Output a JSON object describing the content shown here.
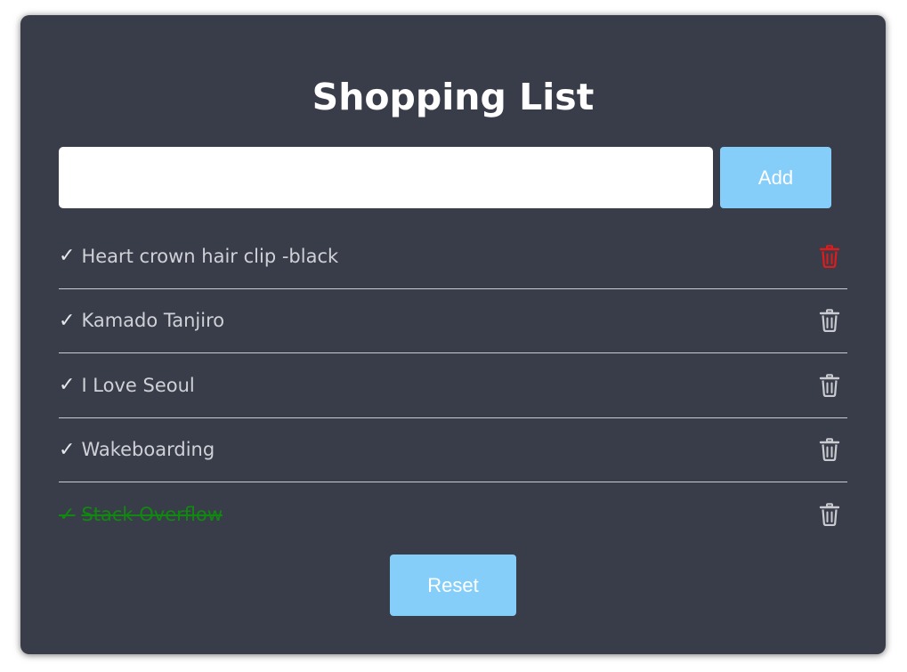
{
  "title": "Shopping List",
  "input": {
    "value": "",
    "placeholder": ""
  },
  "add_label": "Add",
  "reset_label": "Reset",
  "items": [
    {
      "label": "Heart crown hair clip -black",
      "done": false,
      "delete_highlighted": true
    },
    {
      "label": "Kamado Tanjiro",
      "done": false,
      "delete_highlighted": false
    },
    {
      "label": "I Love Seoul",
      "done": false,
      "delete_highlighted": false
    },
    {
      "label": "Wakeboarding",
      "done": false,
      "delete_highlighted": false
    },
    {
      "label": "Stack Overflow",
      "done": true,
      "delete_highlighted": false
    }
  ],
  "check_glyph": "✓",
  "icons": {
    "delete": "trash-icon"
  },
  "colors": {
    "card_bg": "#393d49",
    "button_bg": "#86cefa",
    "done_text": "#0f8a0f",
    "trash_default": "#c9cbd1",
    "trash_highlight": "#e01b1b"
  }
}
